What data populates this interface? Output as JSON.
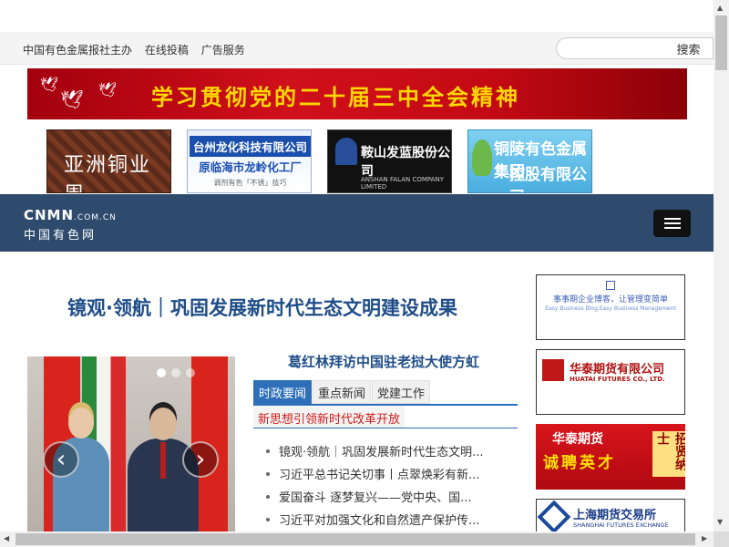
{
  "toplinks": [
    "中国有色金属报社主办",
    "在线投稿",
    "广告服务"
  ],
  "search": {
    "button_label": "搜索",
    "placeholder": ""
  },
  "banner": {
    "text": "学习贯彻党的二十届三中全会精神"
  },
  "ads": {
    "ad1": "亚洲铜业周",
    "ad2": {
      "line1": "台州龙化科技有限公司",
      "line2": "原临海市龙岭化工厂",
      "line3": "调剂有色「不锈」技巧"
    },
    "ad3": {
      "line1": "鞍山发蓝股份公司",
      "line2": "ANSHAN FALAN COMPANY LIMITED"
    },
    "ad4": {
      "line1": "铜陵有色金属集团",
      "line2": "控股有限公司"
    }
  },
  "navbar": {
    "brand_en": "CNMN",
    "brand_domain": ".COM.CN",
    "brand_cn": "中国有色网"
  },
  "main": {
    "headline": "镜观·领航｜巩固发展新时代生态文明建设成果",
    "sub_headline": "葛红林拜访中国驻老挝大使方虹",
    "tabs": [
      {
        "label": "时政要闻"
      },
      {
        "label": "重点新闻"
      },
      {
        "label": "党建工作"
      }
    ],
    "red_link": "新思想引领新时代改革开放",
    "news": [
      "镜观·领航｜巩固发展新时代生态文明...",
      "习近平总书记关切事丨点翠焕彩有新...",
      "爱国奋斗 逐梦复兴——党中央、国...",
      "习近平对加强文化和自然遗产保护传..."
    ]
  },
  "right_ads": {
    "rad1": {
      "line1": "事事期企业博客，让管理变简单",
      "line2": "Easy Business Blog,Easy Business Management"
    },
    "rad2": {
      "line1": "华泰期货有限公司",
      "line2": "HUATAI FUTURES CO., LTD."
    },
    "rad3": {
      "line1": "华泰期货",
      "line2": "诚聘英才",
      "line3": "招贤纳士"
    },
    "rad4": {
      "line1": "上海期货交易所",
      "line2": "SHANGHAI FUTURES EXCHANGE"
    }
  },
  "slider": {
    "prev": "‹",
    "next": "›",
    "active_dot": 0,
    "dot_count": 3
  },
  "scroll": {
    "up": "▲",
    "down": "▼",
    "left": "◀",
    "right": "▶"
  },
  "colors": {
    "nav_bg": "#2e4b6e",
    "headline": "#1f4d88",
    "tab_active": "#2d6fb8",
    "red_link": "#d01a1a"
  }
}
